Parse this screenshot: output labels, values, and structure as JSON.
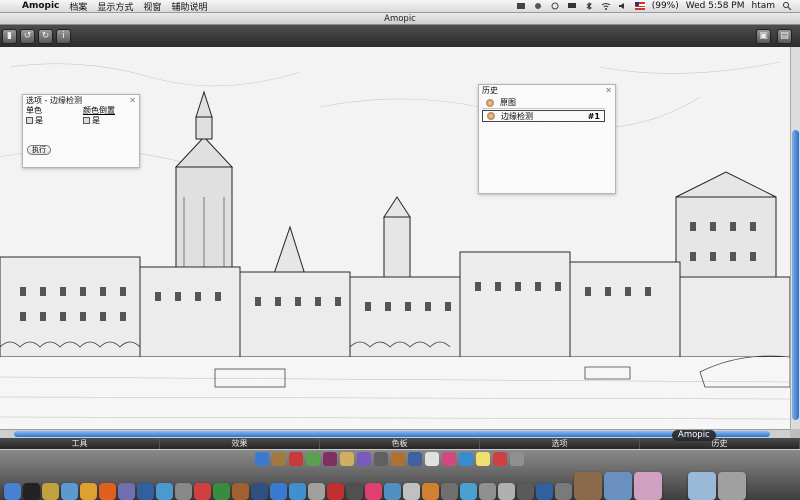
{
  "menubar": {
    "app_name": "Amopic",
    "items": [
      "档案",
      "显示方式",
      "视窗",
      "辅助说明"
    ],
    "battery": "(99%)",
    "clock": "Wed 5:58 PM",
    "user": "htam"
  },
  "window": {
    "title": "Amopic"
  },
  "options_panel": {
    "title": "选项 - 边缘检测",
    "col1_label": "单色",
    "col2_label": "颜色倒置",
    "col1_value": "是",
    "col2_value": "是",
    "run_button": "执行"
  },
  "history_panel": {
    "title": "历史",
    "items": [
      {
        "label": "原图",
        "num": ""
      },
      {
        "label": "边缘检测",
        "num": "#1"
      }
    ]
  },
  "bottom_tabs": [
    "工具",
    "效果",
    "色板",
    "选项",
    "历史"
  ],
  "dock_tooltip": "Amopic",
  "colors": {
    "toolbar": "#3a3a3a",
    "scroll_accent": "#2a6fcf",
    "canvas_bg": "#f4f4f4"
  }
}
